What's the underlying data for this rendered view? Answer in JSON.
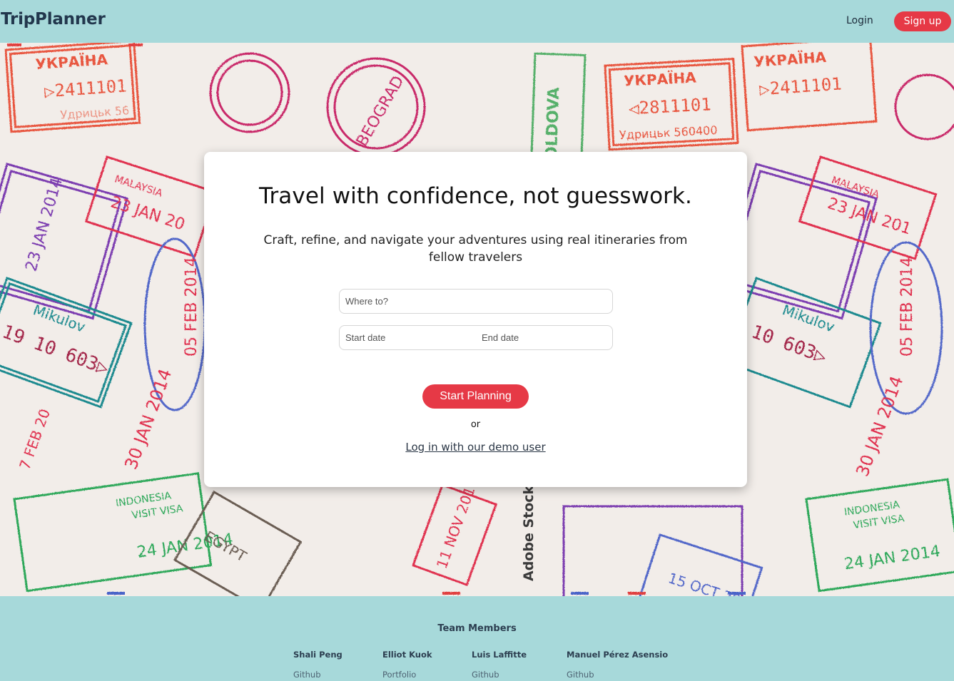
{
  "header": {
    "brand": "TripPlanner",
    "login_label": "Login",
    "signup_label": "Sign up"
  },
  "hero": {
    "background_image": "passport stamps collage",
    "watermark": "Adobe Stock | #"
  },
  "card": {
    "title": "Travel with confidence, not guesswork.",
    "subtitle": "Craft, refine, and navigate your adventures using real itineraries from fellow travelers",
    "where_placeholder": "Where to?",
    "start_date_placeholder": "Start date",
    "end_date_placeholder": "End date",
    "plan_button_label": "Start Planning",
    "or_text": "or",
    "demo_link_label": "Log in with our demo user"
  },
  "footer": {
    "title": "Team Members",
    "members": [
      {
        "name": "Shali Peng",
        "link": "Github"
      },
      {
        "name": "Elliot Kuok",
        "link": "Portfolio"
      },
      {
        "name": "Luis Laffitte",
        "link": "Github"
      },
      {
        "name": "Manuel Pérez Asensio",
        "link": "Github"
      }
    ]
  },
  "colors": {
    "accent": "#e63946",
    "header_bg": "#a7d9da",
    "brand_text": "#22374d"
  }
}
